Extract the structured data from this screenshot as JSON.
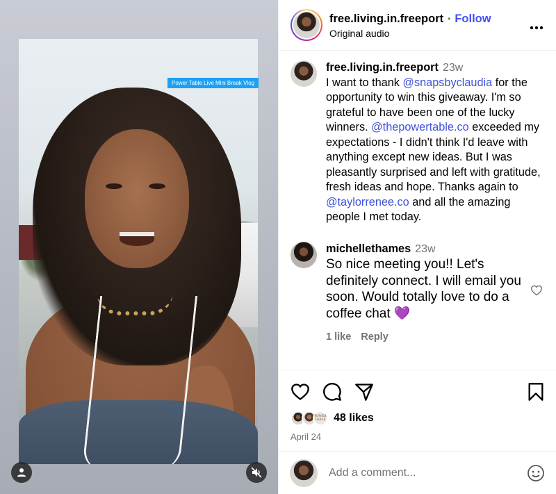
{
  "header": {
    "username": "free.living.in.freeport",
    "separator": "•",
    "follow_label": "Follow",
    "audio_label": "Original audio",
    "more_label": "•••"
  },
  "media": {
    "caption_tag": "Power Table Live Mini Break Vlog"
  },
  "caption": {
    "username": "free.living.in.freeport",
    "time": "23w",
    "part1": " I want to thank ",
    "mention1": "@snapsbyclaudia",
    "part2": " for the opportunity to win this giveaway. I'm so grateful to have been one of the lucky winners. ",
    "mention2": "@thepowertable.co",
    "part3": " exceeded my expectations - I didn't think I'd leave with anything except new ideas. But I was pleasantly surprised and left with gratitude, fresh ideas and hope. Thanks again to ",
    "mention3": "@taylorrenee.co",
    "part4": " and all the amazing people I met today."
  },
  "reply_comment": {
    "username": "michellethames",
    "time": "23w",
    "text": "So nice meeting you!! Let's definitely connect. I will email you soon. Would totally love to do a coffee chat 💜",
    "likes_label": "1 like",
    "reply_label": "Reply"
  },
  "actions": {
    "likes": "48 likes",
    "date": "April 24",
    "liker_badge": "POWER TABLE"
  },
  "composer": {
    "placeholder": "Add a comment..."
  },
  "colors": {
    "link": "#3f51d8",
    "muted": "#737373",
    "divider": "#efefef"
  }
}
